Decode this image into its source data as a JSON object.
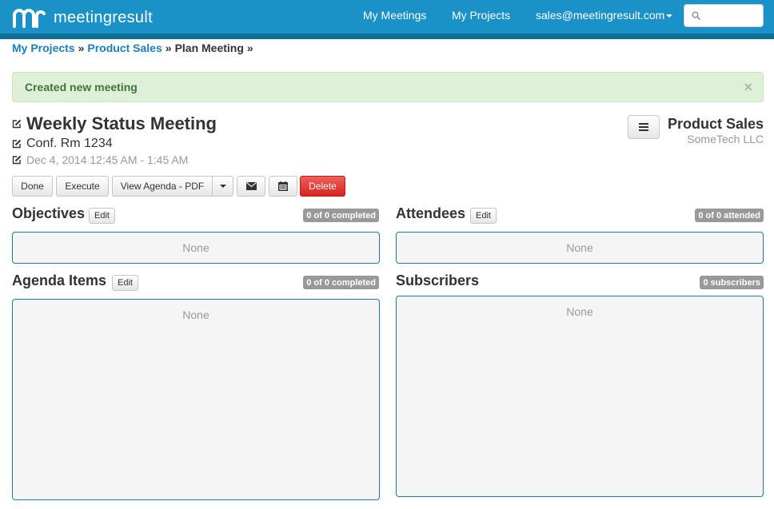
{
  "nav": {
    "brand": "meetingresult",
    "my_meetings": "My Meetings",
    "my_projects": "My Projects",
    "user_email": "sales@meetingresult.com",
    "search_placeholder": ""
  },
  "breadcrumb": {
    "items": [
      "My Projects",
      "Product Sales",
      "Plan Meeting"
    ],
    "separator": "»"
  },
  "alert": {
    "message": "Created new meeting",
    "close": "×"
  },
  "meeting": {
    "title": "Weekly Status Meeting",
    "location": "Conf. Rm 1234",
    "date": "Dec 4, 2014 12:45 AM - 1:45 AM"
  },
  "project": {
    "name": "Product Sales",
    "company": "SomeTech LLC"
  },
  "toolbar": {
    "done": "Done",
    "execute": "Execute",
    "view_agenda": "View Agenda - PDF",
    "delete": "Delete"
  },
  "sections": {
    "objectives": {
      "title": "Objectives",
      "edit": "Edit",
      "badge": "0 of 0 completed",
      "empty": "None"
    },
    "attendees": {
      "title": "Attendees",
      "edit": "Edit",
      "badge": "0 of 0 attended",
      "empty": "None"
    },
    "agenda": {
      "title": "Agenda Items",
      "edit": "Edit",
      "badge": "0 of 0 completed",
      "empty": "None"
    },
    "subscribers": {
      "title": "Subscribers",
      "badge": "0 subscribers",
      "empty": "None"
    }
  },
  "colors": {
    "navbar": "#1a92c7",
    "link": "#1a7fc0",
    "alert_bg": "#dff0d8",
    "alert_text": "#3c763d",
    "danger": "#d9231f"
  },
  "icons": [
    "mr-logo-icon",
    "search-icon",
    "edit-icon",
    "list-icon",
    "caret-down-icon",
    "envelope-icon",
    "calendar-icon",
    "close-icon"
  ]
}
